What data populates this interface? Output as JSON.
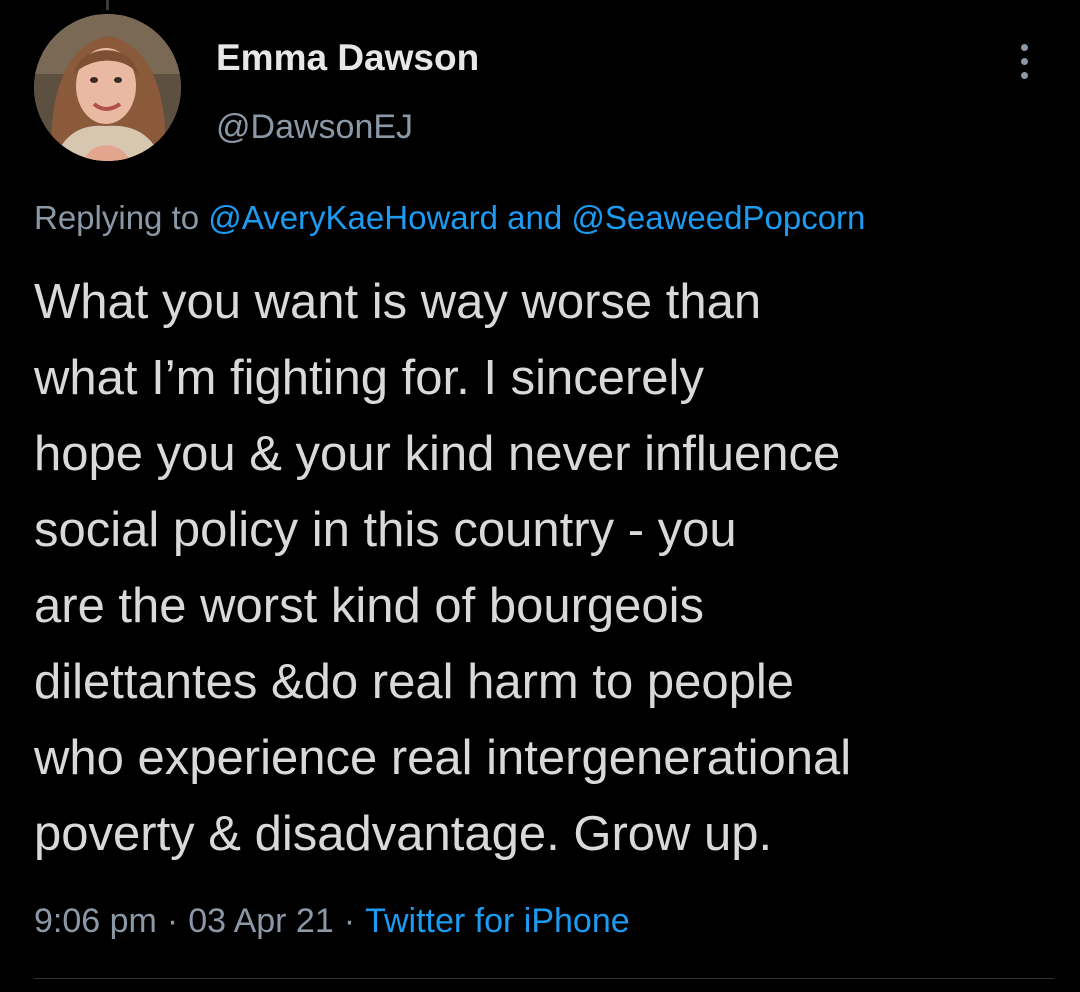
{
  "tweet": {
    "author": {
      "display_name": "Emma Dawson",
      "handle": "@DawsonEJ"
    },
    "more_icon": "more-vertical-icon",
    "replying": {
      "prefix": "Replying to",
      "mention_1": "@AveryKaeHoward",
      "conjunction": "and",
      "mention_2": "@SeaweedPopcorn"
    },
    "body_lines": [
      "What you want is way worse than",
      "what I’m fighting for. I sincerely",
      "hope you & your kind never influence",
      "social policy in this country - you",
      "are the worst kind of bourgeois",
      "dilettantes &do real harm to people",
      "who experience real intergenerational",
      "poverty & disadvantage. Grow up."
    ],
    "time": "9:06 pm",
    "date": "03 Apr 21",
    "separator": "·",
    "source": "Twitter for iPhone"
  },
  "colors": {
    "background": "#000000",
    "text": "#d9d9d9",
    "secondary": "#8b98a5",
    "accent": "#1d9bf0"
  }
}
